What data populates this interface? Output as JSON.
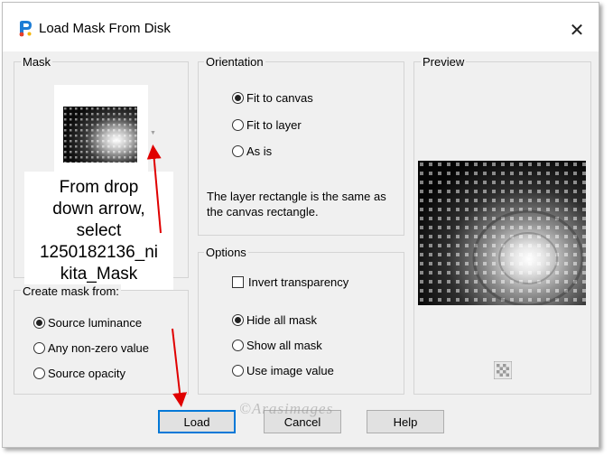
{
  "window": {
    "title": "Load Mask From Disk",
    "close_glyph": "✕"
  },
  "mask": {
    "group_title": "Mask",
    "thumbnail_icon": "tunnel-mask-thumbnail",
    "dropdown_arrow": "▼"
  },
  "callout": {
    "lines": [
      "From drop",
      "down arrow,",
      "select",
      "1250182136_ni",
      "kita_Mask"
    ]
  },
  "create_from": {
    "group_title": "Create mask from:",
    "options": [
      {
        "label": "Source luminance",
        "checked": true
      },
      {
        "label": "Any non-zero value",
        "checked": false
      },
      {
        "label": "Source opacity",
        "checked": false
      }
    ]
  },
  "orientation": {
    "group_title": "Orientation",
    "options": [
      {
        "label": "Fit to canvas",
        "checked": true
      },
      {
        "label": "Fit to layer",
        "checked": false
      },
      {
        "label": "As is",
        "checked": false
      }
    ],
    "info_lines": [
      "The layer rectangle is the same as",
      "the canvas rectangle."
    ]
  },
  "options": {
    "group_title": "Options",
    "invert_label": "Invert transparency",
    "invert_checked": false,
    "display_options": [
      {
        "label": "Hide all mask",
        "checked": true
      },
      {
        "label": "Show all mask",
        "checked": false
      },
      {
        "label": "Use image value",
        "checked": false
      }
    ]
  },
  "preview": {
    "group_title": "Preview",
    "background_icon": "checkerboard-icon"
  },
  "buttons": {
    "load": "Load",
    "cancel": "Cancel",
    "help": "Help"
  },
  "watermark": "©Arasimages",
  "colors": {
    "accent": "#0078d7",
    "annotation_arrow": "#e00000",
    "dialog_bg": "#f0f0f0"
  }
}
